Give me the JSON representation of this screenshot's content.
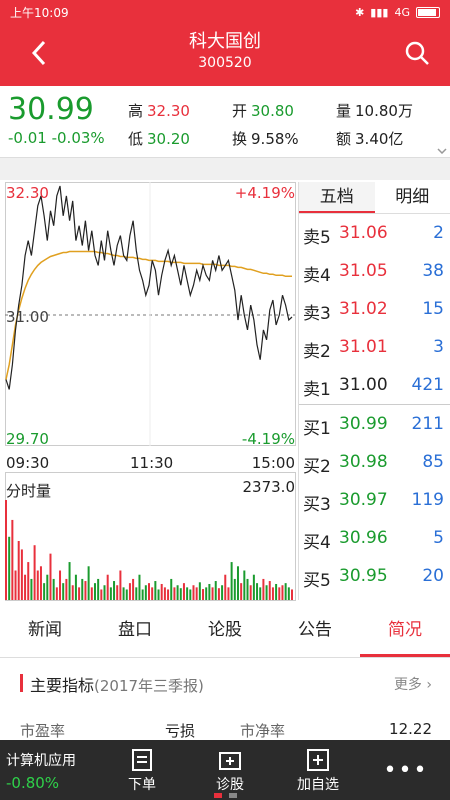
{
  "status": {
    "time": "上午10:09",
    "network": "4G"
  },
  "header": {
    "title": "科大国创",
    "code": "300520"
  },
  "quote": {
    "price": "30.99",
    "change": "-0.01",
    "change_pct": "-0.03%",
    "high_label": "高",
    "high": "32.30",
    "low_label": "低",
    "low": "30.20",
    "open_label": "开",
    "open": "30.80",
    "turnover_label": "换",
    "turnover": "9.58%",
    "volume_label": "量",
    "volume": "10.80万",
    "amount_label": "额",
    "amount": "3.40亿"
  },
  "chart_labels": {
    "price_high": "32.30",
    "price_low": "29.70",
    "price_mid": "31.00",
    "pct_high": "+4.19%",
    "pct_low": "-4.19%",
    "time_start": "09:30",
    "time_mid": "11:30",
    "time_end": "15:00",
    "volume_title": "分时量",
    "volume_max": "2373.0"
  },
  "chart_data": {
    "type": "line",
    "ylim": [
      29.7,
      32.3
    ],
    "prev_close": 31.0,
    "series": [],
    "price": [
      30.35,
      30.25,
      30.5,
      30.85,
      31.1,
      31.3,
      31.6,
      31.75,
      31.6,
      31.85,
      32.1,
      32.2,
      32.0,
      31.75,
      32.05,
      31.9,
      32.2,
      32.3,
      32.0,
      32.2,
      31.95,
      32.15,
      31.75,
      31.9,
      31.7,
      31.95,
      31.65,
      31.85,
      31.6,
      31.5,
      31.75,
      31.55,
      31.85,
      31.65,
      31.5,
      31.7,
      31.8,
      31.6,
      31.55,
      31.8,
      31.95,
      31.65,
      31.45,
      31.35,
      31.2,
      31.3,
      31.55,
      31.45,
      31.2,
      31.4,
      31.55,
      31.65,
      31.5,
      31.6,
      31.45,
      31.3,
      31.5,
      31.35,
      31.2,
      31.3,
      31.45,
      31.35,
      31.5,
      31.4,
      31.35,
      31.55,
      31.45,
      31.6,
      31.45,
      31.5,
      31.55,
      31.4,
      31.25,
      30.95,
      31.2,
      31.0,
      30.85,
      31.1,
      30.95,
      30.7,
      30.55,
      30.85,
      30.75,
      31.05,
      31.15,
      30.9,
      31.0,
      31.2,
      31.1,
      30.95,
      30.98
    ],
    "avg": [
      30.35,
      30.5,
      30.7,
      30.9,
      31.05,
      31.17,
      31.27,
      31.35,
      31.41,
      31.46,
      31.5,
      31.53,
      31.55,
      31.57,
      31.59,
      31.6,
      31.61,
      31.62,
      31.63,
      31.63,
      31.64,
      31.64,
      31.64,
      31.64,
      31.64,
      31.64,
      31.64,
      31.64,
      31.64,
      31.63,
      31.63,
      31.62,
      31.62,
      31.61,
      31.6,
      31.6,
      31.59,
      31.59,
      31.58,
      31.58,
      31.58,
      31.57,
      31.57,
      31.56,
      31.56,
      31.55,
      31.55,
      31.55,
      31.54,
      31.54,
      31.54,
      31.54,
      31.53,
      31.53,
      31.53,
      31.53,
      31.52,
      31.52,
      31.52,
      31.52,
      31.52,
      31.52,
      31.51,
      31.51,
      31.51,
      31.51,
      31.51,
      31.5,
      31.5,
      31.5,
      31.5,
      31.49,
      31.49,
      31.48,
      31.48,
      31.47,
      31.46,
      31.46,
      31.45,
      31.44,
      31.43,
      31.42,
      31.42,
      31.41,
      31.41,
      31.4,
      31.4,
      31.4,
      31.39,
      31.39,
      31.39
    ],
    "volume": [
      2373,
      1500,
      1900,
      700,
      1400,
      1200,
      600,
      900,
      500,
      1300,
      700,
      800,
      400,
      600,
      1100,
      500,
      300,
      700,
      400,
      500,
      900,
      350,
      600,
      300,
      500,
      450,
      800,
      300,
      400,
      500,
      250,
      350,
      600,
      300,
      450,
      350,
      700,
      300,
      250,
      400,
      500,
      300,
      600,
      250,
      350,
      400,
      300,
      450,
      250,
      380,
      300,
      250,
      500,
      300,
      350,
      280,
      400,
      300,
      250,
      350,
      300,
      420,
      260,
      300,
      380,
      300,
      450,
      280,
      350,
      600,
      300,
      900,
      500,
      800,
      400,
      700,
      500,
      350,
      600,
      400,
      300,
      500,
      350,
      450,
      300,
      380,
      300,
      350,
      400,
      300,
      250
    ]
  },
  "order_book": {
    "tabs": [
      "五档",
      "明细"
    ],
    "sells": [
      {
        "label": "卖5",
        "price": "31.06",
        "vol": "2",
        "color": "#e8303c"
      },
      {
        "label": "卖4",
        "price": "31.05",
        "vol": "38",
        "color": "#e8303c"
      },
      {
        "label": "卖3",
        "price": "31.02",
        "vol": "15",
        "color": "#e8303c"
      },
      {
        "label": "卖2",
        "price": "31.01",
        "vol": "3",
        "color": "#e8303c"
      },
      {
        "label": "卖1",
        "price": "31.00",
        "vol": "421",
        "color": "#222222"
      }
    ],
    "buys": [
      {
        "label": "买1",
        "price": "30.99",
        "vol": "211",
        "color": "#1a9b2e"
      },
      {
        "label": "买2",
        "price": "30.98",
        "vol": "85",
        "color": "#1a9b2e"
      },
      {
        "label": "买3",
        "price": "30.97",
        "vol": "119",
        "color": "#1a9b2e"
      },
      {
        "label": "买4",
        "price": "30.96",
        "vol": "5",
        "color": "#1a9b2e"
      },
      {
        "label": "买5",
        "price": "30.95",
        "vol": "20",
        "color": "#1a9b2e"
      }
    ]
  },
  "tabs": [
    "新闻",
    "盘口",
    "论股",
    "公告",
    "简况"
  ],
  "active_tab": 4,
  "profile": {
    "title": "主要指标",
    "subtitle": "(2017年三季报)",
    "more": "更多",
    "row": [
      "市盈率",
      "亏损",
      "市净率",
      "12.22"
    ]
  },
  "nav": {
    "index_name": "计算机应用",
    "index_pct": "-0.80%",
    "order": "下单",
    "diagnose": "诊股",
    "add_watch": "加自选"
  }
}
